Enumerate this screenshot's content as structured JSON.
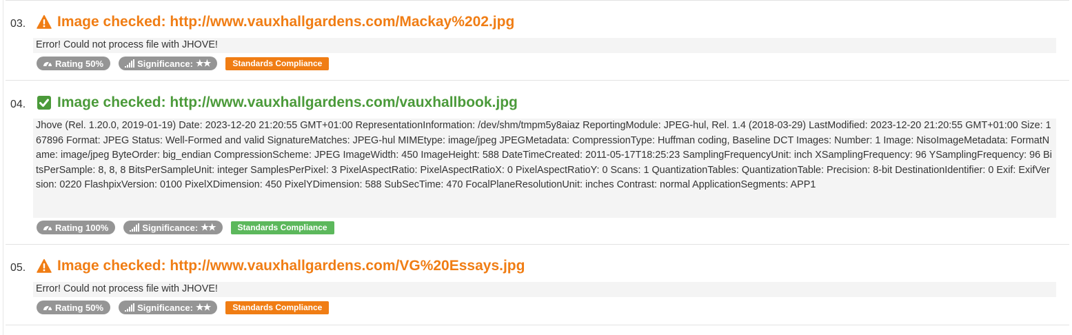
{
  "colors": {
    "warn": "#f07d14",
    "ok": "#4b9a3a",
    "badge_grey": "#959595",
    "std_warn": "#f07d14",
    "std_ok": "#5cb85c"
  },
  "entries": [
    {
      "number": "03.",
      "status": "warning",
      "status_icon": "warning-triangle-icon",
      "title": "Image checked: http://www.vauxhallgardens.com/Mackay%202.jpg",
      "message": "Error! Could not process file with JHOVE!",
      "rating": "Rating 50%",
      "significance": "Significance:",
      "stars": 2,
      "category": "Standards Compliance"
    },
    {
      "number": "04.",
      "status": "ok",
      "status_icon": "check-square-icon",
      "title": "Image checked: http://www.vauxhallgardens.com/vauxhallbook.jpg",
      "message": "Jhove (Rel. 1.20.0, 2019-01-19) Date: 2023-12-20 21:20:55 GMT+01:00 RepresentationInformation: /dev/shm/tmpm5y8aiaz ReportingModule: JPEG-hul, Rel. 1.4 (2018-03-29) LastModified: 2023-12-20 21:20:55 GMT+01:00 Size: 167896 Format: JPEG Status: Well-Formed and valid SignatureMatches: JPEG-hul MIMEtype: image/jpeg JPEGMetadata: CompressionType: Huffman coding, Baseline DCT Images: Number: 1 Image: NisoImageMetadata: FormatName: image/jpeg ByteOrder: big_endian CompressionScheme: JPEG ImageWidth: 450 ImageHeight: 588 DateTimeCreated: 2011-05-17T18:25:23 SamplingFrequencyUnit: inch XSamplingFrequency: 96 YSamplingFrequency: 96 BitsPerSample: 8, 8, 8 BitsPerSampleUnit: integer SamplesPerPixel: 3 PixelAspectRatio: PixelAspectRatioX: 0 PixelAspectRatioY: 0 Scans: 1 QuantizationTables: QuantizationTable: Precision: 8-bit DestinationIdentifier: 0 Exif: ExifVersion: 0220 FlashpixVersion: 0100 PixelXDimension: 450 PixelYDimension: 588 SubSecTime: 470 FocalPlaneResolutionUnit: inches Contrast: normal ApplicationSegments: APP1",
      "rating": "Rating 100%",
      "significance": "Significance:",
      "stars": 2,
      "category": "Standards Compliance"
    },
    {
      "number": "05.",
      "status": "warning",
      "status_icon": "warning-triangle-icon",
      "title": "Image checked: http://www.vauxhallgardens.com/VG%20Essays.jpg",
      "message": "Error! Could not process file with JHOVE!",
      "rating": "Rating 50%",
      "significance": "Significance:",
      "stars": 2,
      "category": "Standards Compliance"
    }
  ]
}
